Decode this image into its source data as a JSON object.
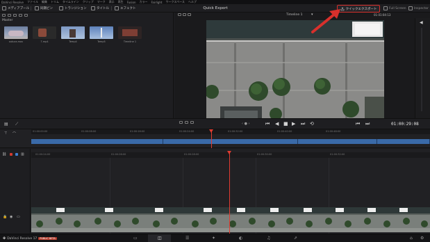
{
  "menubar": {
    "items": [
      "DaVinci Resolve",
      "ファイル",
      "編集",
      "トリム",
      "タイムライン",
      "クリップ",
      "マーク",
      "表示",
      "再生",
      "Fusion",
      "カラー",
      "Fairlight",
      "ワークスペース",
      "ヘルプ"
    ]
  },
  "toolbar": {
    "media_pool_label": "メディアプール",
    "sync_bin_label": "同期ビン",
    "transitions_label": "トランジション",
    "titles_label": "タイトル",
    "effects_label": "エフェクト",
    "quick_export_title": "Quick Export",
    "quick_export_button": "クイックエクスポート",
    "full_screen_label": "Full Screen",
    "inspector_label": "Inspector"
  },
  "media_pool": {
    "bin_name": "Master",
    "clips": [
      {
        "name": "sakura.mov"
      },
      {
        "name": "7.mp4"
      },
      {
        "name": "Temp4"
      },
      {
        "name": "Temp5"
      },
      {
        "name": "Timeline 1"
      }
    ]
  },
  "viewer": {
    "timeline_name": "Timeline 1",
    "timecode_small": "01:01:04:13"
  },
  "transport": {
    "timecode": "01:00:29:08"
  },
  "upper_ruler": {
    "labels": [
      "01:00:00:00",
      "01:00:08:00",
      "01:00:16:00",
      "01:00:24:00",
      "01:00:32:00",
      "01:00:40:00",
      "01:00:48:00"
    ]
  },
  "lower_ruler": {
    "labels": [
      "01:00:24:00",
      "01:00:26:00",
      "01:00:28:00",
      "01:00:30:00",
      "01:00:32:00"
    ]
  },
  "bottom": {
    "app_name": "DaVinci Resolve 17",
    "badge": "PUBLIC BETA"
  },
  "colors": {
    "accent_red": "#d8302c",
    "clip_blue": "#3a6aa8",
    "playhead": "#e03c31"
  }
}
